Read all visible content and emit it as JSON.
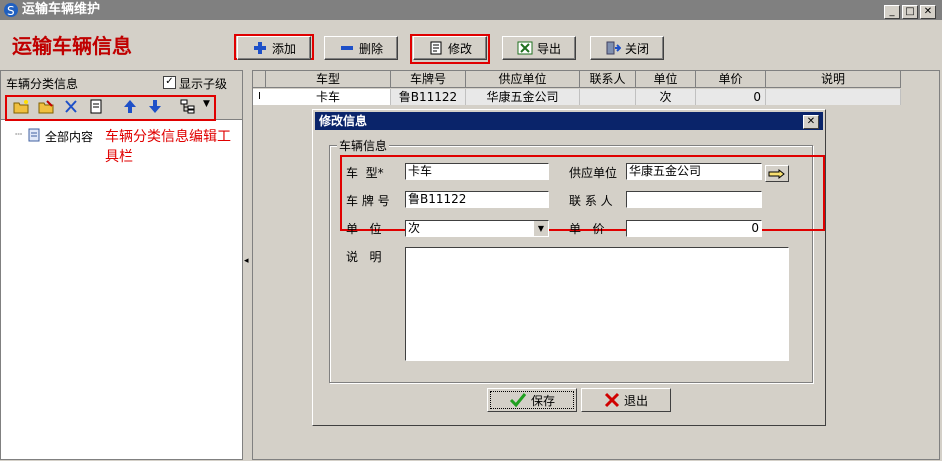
{
  "window": {
    "title": "运输车辆维护",
    "min": "_",
    "max": "□",
    "close": "✕"
  },
  "headline": "运输车辆信息",
  "toolbar": {
    "add": "添加",
    "delete": "删除",
    "edit": "修改",
    "export": "导出",
    "close": "关闭"
  },
  "left": {
    "header": "车辆分类信息",
    "show_children": "显示子级",
    "tree_root": "全部内容",
    "annotation": "车辆分类信息编辑工具栏"
  },
  "grid": {
    "columns": [
      "车型",
      "车牌号",
      "供应单位",
      "联系人",
      "单位",
      "单价",
      "说明"
    ],
    "rows": [
      {
        "marker": "I",
        "cells": [
          "卡车",
          "鲁B11122",
          "华康五金公司",
          "",
          "次",
          "0",
          ""
        ]
      }
    ]
  },
  "dialog": {
    "title": "修改信息",
    "close": "✕",
    "group": "车辆信息",
    "labels": {
      "type": "车  型*",
      "supplier": "供应单位",
      "plate": "车 牌 号",
      "contact": "联 系 人",
      "unit": "单   位",
      "price": "单   价",
      "note": "说   明"
    },
    "values": {
      "type": "卡车",
      "supplier": "华康五金公司",
      "plate": "鲁B11122",
      "contact": "",
      "unit": "次",
      "price": "0",
      "note": ""
    },
    "save": "保存",
    "exit": "退出"
  },
  "colors": {
    "highlight_red": "#e00000",
    "headline_red": "#c00000",
    "title_blue": "#0a246a"
  }
}
